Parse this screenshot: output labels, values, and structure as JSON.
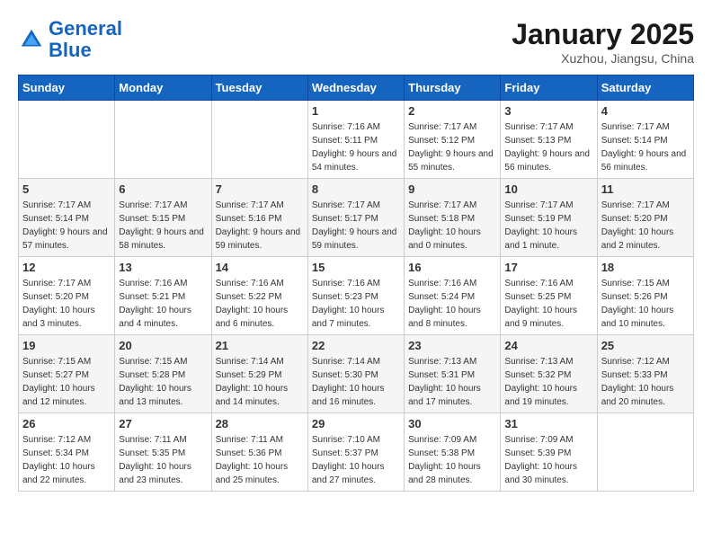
{
  "header": {
    "logo_line1": "General",
    "logo_line2": "Blue",
    "month": "January 2025",
    "location": "Xuzhou, Jiangsu, China"
  },
  "days_of_week": [
    "Sunday",
    "Monday",
    "Tuesday",
    "Wednesday",
    "Thursday",
    "Friday",
    "Saturday"
  ],
  "weeks": [
    [
      {
        "day": "",
        "sunrise": "",
        "sunset": "",
        "daylight": ""
      },
      {
        "day": "",
        "sunrise": "",
        "sunset": "",
        "daylight": ""
      },
      {
        "day": "",
        "sunrise": "",
        "sunset": "",
        "daylight": ""
      },
      {
        "day": "1",
        "sunrise": "Sunrise: 7:16 AM",
        "sunset": "Sunset: 5:11 PM",
        "daylight": "Daylight: 9 hours and 54 minutes."
      },
      {
        "day": "2",
        "sunrise": "Sunrise: 7:17 AM",
        "sunset": "Sunset: 5:12 PM",
        "daylight": "Daylight: 9 hours and 55 minutes."
      },
      {
        "day": "3",
        "sunrise": "Sunrise: 7:17 AM",
        "sunset": "Sunset: 5:13 PM",
        "daylight": "Daylight: 9 hours and 56 minutes."
      },
      {
        "day": "4",
        "sunrise": "Sunrise: 7:17 AM",
        "sunset": "Sunset: 5:14 PM",
        "daylight": "Daylight: 9 hours and 56 minutes."
      }
    ],
    [
      {
        "day": "5",
        "sunrise": "Sunrise: 7:17 AM",
        "sunset": "Sunset: 5:14 PM",
        "daylight": "Daylight: 9 hours and 57 minutes."
      },
      {
        "day": "6",
        "sunrise": "Sunrise: 7:17 AM",
        "sunset": "Sunset: 5:15 PM",
        "daylight": "Daylight: 9 hours and 58 minutes."
      },
      {
        "day": "7",
        "sunrise": "Sunrise: 7:17 AM",
        "sunset": "Sunset: 5:16 PM",
        "daylight": "Daylight: 9 hours and 59 minutes."
      },
      {
        "day": "8",
        "sunrise": "Sunrise: 7:17 AM",
        "sunset": "Sunset: 5:17 PM",
        "daylight": "Daylight: 9 hours and 59 minutes."
      },
      {
        "day": "9",
        "sunrise": "Sunrise: 7:17 AM",
        "sunset": "Sunset: 5:18 PM",
        "daylight": "Daylight: 10 hours and 0 minutes."
      },
      {
        "day": "10",
        "sunrise": "Sunrise: 7:17 AM",
        "sunset": "Sunset: 5:19 PM",
        "daylight": "Daylight: 10 hours and 1 minute."
      },
      {
        "day": "11",
        "sunrise": "Sunrise: 7:17 AM",
        "sunset": "Sunset: 5:20 PM",
        "daylight": "Daylight: 10 hours and 2 minutes."
      }
    ],
    [
      {
        "day": "12",
        "sunrise": "Sunrise: 7:17 AM",
        "sunset": "Sunset: 5:20 PM",
        "daylight": "Daylight: 10 hours and 3 minutes."
      },
      {
        "day": "13",
        "sunrise": "Sunrise: 7:16 AM",
        "sunset": "Sunset: 5:21 PM",
        "daylight": "Daylight: 10 hours and 4 minutes."
      },
      {
        "day": "14",
        "sunrise": "Sunrise: 7:16 AM",
        "sunset": "Sunset: 5:22 PM",
        "daylight": "Daylight: 10 hours and 6 minutes."
      },
      {
        "day": "15",
        "sunrise": "Sunrise: 7:16 AM",
        "sunset": "Sunset: 5:23 PM",
        "daylight": "Daylight: 10 hours and 7 minutes."
      },
      {
        "day": "16",
        "sunrise": "Sunrise: 7:16 AM",
        "sunset": "Sunset: 5:24 PM",
        "daylight": "Daylight: 10 hours and 8 minutes."
      },
      {
        "day": "17",
        "sunrise": "Sunrise: 7:16 AM",
        "sunset": "Sunset: 5:25 PM",
        "daylight": "Daylight: 10 hours and 9 minutes."
      },
      {
        "day": "18",
        "sunrise": "Sunrise: 7:15 AM",
        "sunset": "Sunset: 5:26 PM",
        "daylight": "Daylight: 10 hours and 10 minutes."
      }
    ],
    [
      {
        "day": "19",
        "sunrise": "Sunrise: 7:15 AM",
        "sunset": "Sunset: 5:27 PM",
        "daylight": "Daylight: 10 hours and 12 minutes."
      },
      {
        "day": "20",
        "sunrise": "Sunrise: 7:15 AM",
        "sunset": "Sunset: 5:28 PM",
        "daylight": "Daylight: 10 hours and 13 minutes."
      },
      {
        "day": "21",
        "sunrise": "Sunrise: 7:14 AM",
        "sunset": "Sunset: 5:29 PM",
        "daylight": "Daylight: 10 hours and 14 minutes."
      },
      {
        "day": "22",
        "sunrise": "Sunrise: 7:14 AM",
        "sunset": "Sunset: 5:30 PM",
        "daylight": "Daylight: 10 hours and 16 minutes."
      },
      {
        "day": "23",
        "sunrise": "Sunrise: 7:13 AM",
        "sunset": "Sunset: 5:31 PM",
        "daylight": "Daylight: 10 hours and 17 minutes."
      },
      {
        "day": "24",
        "sunrise": "Sunrise: 7:13 AM",
        "sunset": "Sunset: 5:32 PM",
        "daylight": "Daylight: 10 hours and 19 minutes."
      },
      {
        "day": "25",
        "sunrise": "Sunrise: 7:12 AM",
        "sunset": "Sunset: 5:33 PM",
        "daylight": "Daylight: 10 hours and 20 minutes."
      }
    ],
    [
      {
        "day": "26",
        "sunrise": "Sunrise: 7:12 AM",
        "sunset": "Sunset: 5:34 PM",
        "daylight": "Daylight: 10 hours and 22 minutes."
      },
      {
        "day": "27",
        "sunrise": "Sunrise: 7:11 AM",
        "sunset": "Sunset: 5:35 PM",
        "daylight": "Daylight: 10 hours and 23 minutes."
      },
      {
        "day": "28",
        "sunrise": "Sunrise: 7:11 AM",
        "sunset": "Sunset: 5:36 PM",
        "daylight": "Daylight: 10 hours and 25 minutes."
      },
      {
        "day": "29",
        "sunrise": "Sunrise: 7:10 AM",
        "sunset": "Sunset: 5:37 PM",
        "daylight": "Daylight: 10 hours and 27 minutes."
      },
      {
        "day": "30",
        "sunrise": "Sunrise: 7:09 AM",
        "sunset": "Sunset: 5:38 PM",
        "daylight": "Daylight: 10 hours and 28 minutes."
      },
      {
        "day": "31",
        "sunrise": "Sunrise: 7:09 AM",
        "sunset": "Sunset: 5:39 PM",
        "daylight": "Daylight: 10 hours and 30 minutes."
      },
      {
        "day": "",
        "sunrise": "",
        "sunset": "",
        "daylight": ""
      }
    ]
  ]
}
